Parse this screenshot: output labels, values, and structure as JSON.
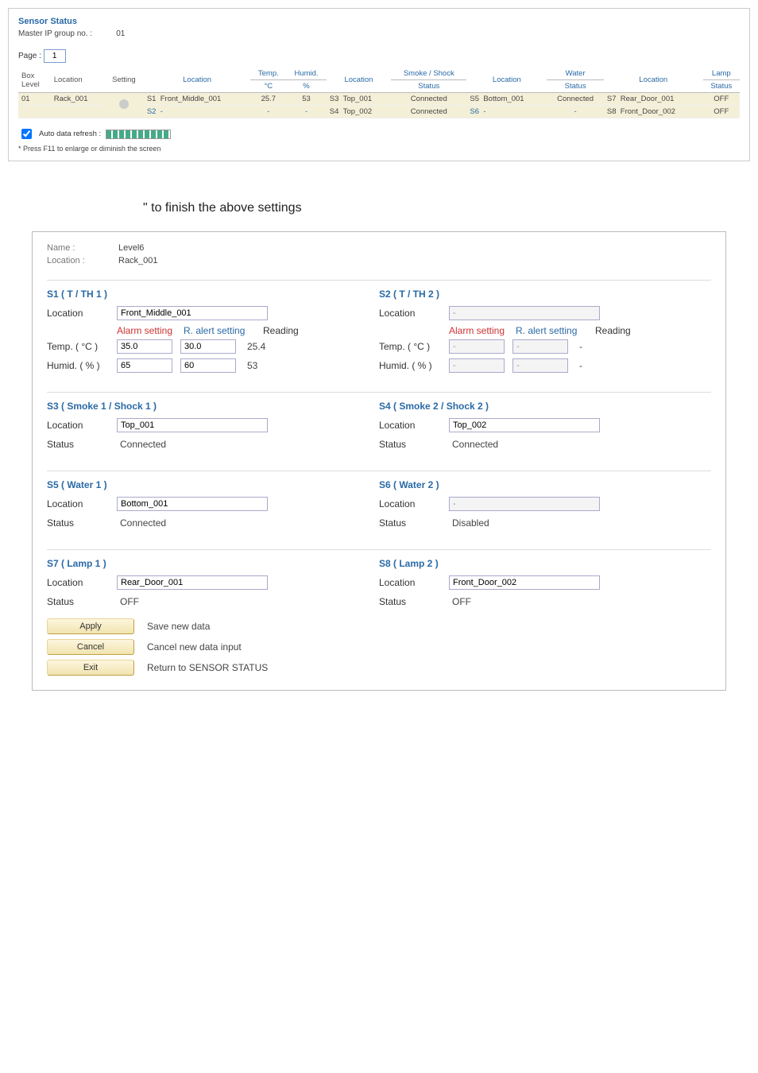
{
  "top": {
    "title": "Sensor Status",
    "master_label": "Master IP group no. :",
    "master_val": "01",
    "page_label": "Page :",
    "page_val": "1",
    "headers": {
      "box_level": "Box\nLevel",
      "location1": "Location",
      "setting": "Setting",
      "s_location": "Location",
      "temp": "Temp.\n°C",
      "humid": "Humid.\n%",
      "ss_location": "Location",
      "smoke_shock": "Smoke / Shock\nStatus",
      "w_location": "Location",
      "water": "Water\nStatus",
      "l_location": "Location",
      "lamp": "Lamp\nStatus"
    },
    "row": {
      "level": "01",
      "rack": "Rack_001",
      "s1_id": "S1",
      "s1_loc": "Front_Middle_001",
      "s1_temp": "25.7",
      "s1_humid": "53",
      "s2_id": "S2",
      "s2_loc": "-",
      "s2_temp": "-",
      "s2_humid": "-",
      "s3_id": "S3",
      "s3_loc": "Top_001",
      "s3_stat": "Connected",
      "s4_id": "S4",
      "s4_loc": "Top_002",
      "s4_stat": "Connected",
      "s5_id": "S5",
      "s5_loc": "Bottom_001",
      "s5_stat": "Connected",
      "s6_id": "S6",
      "s6_loc": "-",
      "s6_stat": "-",
      "s7_id": "S7",
      "s7_loc": "Rear_Door_001",
      "s7_stat": "OFF",
      "s8_id": "S8",
      "s8_loc": "Front_Door_002",
      "s8_stat": "OFF"
    },
    "auto_refresh_label": "Auto data refresh :",
    "footnote": "* Press F11 to enlarge or diminish the screen"
  },
  "caption": "\" to finish the above settings",
  "detail": {
    "name_label": "Name :",
    "name_val": "Level6",
    "loc_label": "Location :",
    "loc_val": "Rack_001",
    "s1": {
      "title": "S1 ( T / TH 1 )",
      "loc_label": "Location",
      "loc_val": "Front_Middle_001",
      "h_alarm": "Alarm setting",
      "h_ralert": "R. alert setting",
      "h_reading": "Reading",
      "temp_label": "Temp. ( °C )",
      "temp_alarm": "35.0",
      "temp_ralert": "30.0",
      "temp_read": "25.4",
      "humid_label": "Humid. ( % )",
      "humid_alarm": "65",
      "humid_ralert": "60",
      "humid_read": "53"
    },
    "s2": {
      "title": "S2 ( T / TH 2 )",
      "loc_label": "Location",
      "loc_val": "-",
      "h_alarm": "Alarm setting",
      "h_ralert": "R. alert setting",
      "h_reading": "Reading",
      "temp_label": "Temp. ( °C )",
      "temp_alarm": "-",
      "temp_ralert": "-",
      "temp_read": "-",
      "humid_label": "Humid. ( % )",
      "humid_alarm": "-",
      "humid_ralert": "-",
      "humid_read": "-"
    },
    "s3": {
      "title": "S3 ( Smoke 1 / Shock 1 )",
      "loc_label": "Location",
      "loc_val": "Top_001",
      "stat_label": "Status",
      "stat_val": "Connected"
    },
    "s4": {
      "title": "S4 ( Smoke 2 / Shock 2 )",
      "loc_label": "Location",
      "loc_val": "Top_002",
      "stat_label": "Status",
      "stat_val": "Connected"
    },
    "s5": {
      "title": "S5 ( Water 1 )",
      "loc_label": "Location",
      "loc_val": "Bottom_001",
      "stat_label": "Status",
      "stat_val": "Connected"
    },
    "s6": {
      "title": "S6 ( Water 2 )",
      "loc_label": "Location",
      "loc_val": "-",
      "stat_label": "Status",
      "stat_val": "Disabled"
    },
    "s7": {
      "title": "S7 ( Lamp 1 )",
      "loc_label": "Location",
      "loc_val": "Rear_Door_001",
      "stat_label": "Status",
      "stat_val": "OFF"
    },
    "s8": {
      "title": "S8 ( Lamp 2 )",
      "loc_label": "Location",
      "loc_val": "Front_Door_002",
      "stat_label": "Status",
      "stat_val": "OFF"
    },
    "actions": {
      "apply": "Apply",
      "apply_desc": "Save new data",
      "cancel": "Cancel",
      "cancel_desc": "Cancel new data input",
      "exit": "Exit",
      "exit_desc": "Return to SENSOR STATUS"
    }
  }
}
